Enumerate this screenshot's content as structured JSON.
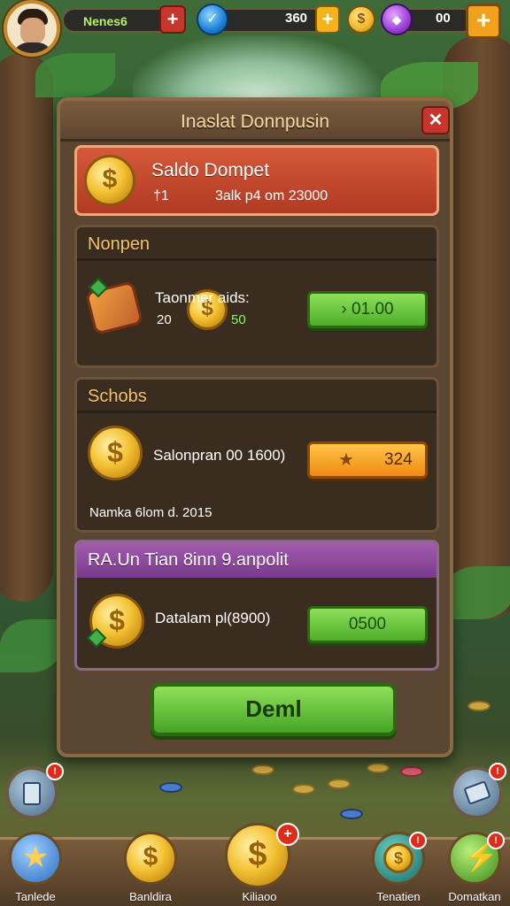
{
  "top_bar": {
    "player_name": "Nenes6",
    "gem_count": "360",
    "purple_count": "00"
  },
  "panel": {
    "title": "Inaslat Donnpusin",
    "saldo": {
      "title": "Saldo Dompet",
      "sub_left": "†1",
      "sub_right": "3alk p4 om 23000"
    },
    "nonpen": {
      "heading": "Nonpen",
      "text": "Taonmer aids:",
      "sub": "20",
      "coin_label": "50",
      "button_label": "› 01.00"
    },
    "schobs": {
      "heading": "Schobs",
      "text": "Salonpran 00 1600)",
      "button_value": "324",
      "footer": "Namka 6lom d. 2015"
    },
    "promo": {
      "heading": "RA.Un Tian 8inn 9.anpolit",
      "text": "Datalam pl(8900)",
      "button_label": "0500"
    },
    "main_button": "Deml"
  },
  "bottom_nav": [
    {
      "label": "Tanlede",
      "icon": "star-icon"
    },
    {
      "label": "Banldira",
      "icon": "coin-icon"
    },
    {
      "label": "Kiliaoo",
      "icon": "coin-icon"
    },
    {
      "label": "Tenatien",
      "icon": "coin-stack-icon"
    },
    {
      "label": "Domatkan",
      "icon": "leaf-icon"
    }
  ],
  "badges": {
    "badge": "!"
  },
  "colors": {
    "accent_green": "#4fae2a",
    "accent_orange": "#f08a12",
    "panel_brown": "#5b4632",
    "saldo_red": "#c0452a",
    "promo_purple": "#8a3a9a"
  }
}
